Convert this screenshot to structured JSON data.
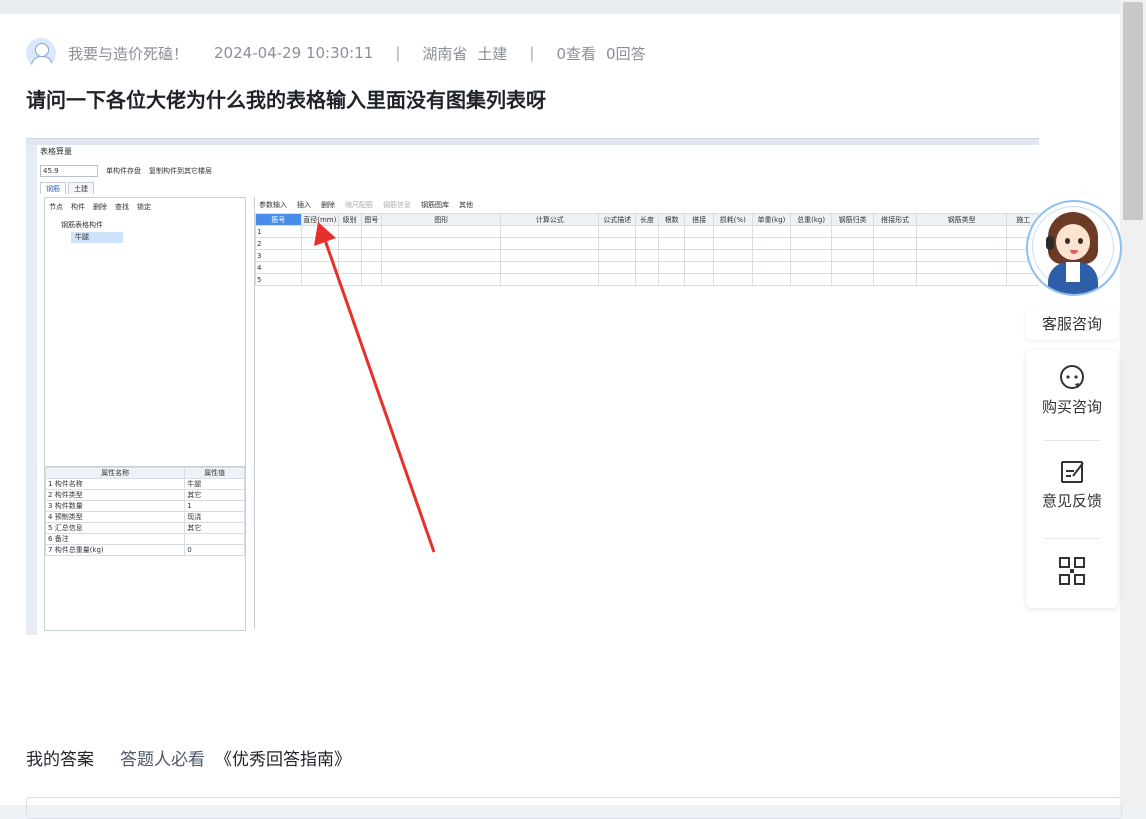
{
  "question": {
    "author": "我要与造价死磕！",
    "datetime": "2024-04-29 10:30:11",
    "separator": "|",
    "region": "湖南省",
    "category": "土建",
    "views": "0查看",
    "answers": "0回答",
    "title": "请问一下各位大佬为什么我的表格输入里面没有图集列表呀"
  },
  "screenshot": {
    "window_title": "表格算量",
    "floor_select": "45.9",
    "toolbar1": [
      "单构件存盘",
      "复制构件到其它楼层"
    ],
    "tabs": [
      "钢筋",
      "土建"
    ],
    "left_toolbar": [
      "节点",
      "构件",
      "删除",
      "查找",
      "锁定"
    ],
    "tree_root": "钢筋表格构件",
    "tree_child": "牛腿",
    "prop_headers": [
      "属性名称",
      "属性值"
    ],
    "props": [
      {
        "n": "1",
        "name": "构件名称",
        "value": "牛腿"
      },
      {
        "n": "2",
        "name": "构件类型",
        "value": "其它"
      },
      {
        "n": "3",
        "name": "构件数量",
        "value": "1"
      },
      {
        "n": "4",
        "name": "预制类型",
        "value": "现浇"
      },
      {
        "n": "5",
        "name": "汇总信息",
        "value": "其它"
      },
      {
        "n": "6",
        "name": "备注",
        "value": ""
      },
      {
        "n": "7",
        "name": "构件总重量(kg)",
        "value": "0"
      }
    ],
    "right_toolbar": [
      "参数输入",
      "插入",
      "删除",
      "缩尺配筋",
      "钢筋信息",
      "钢筋图库",
      "其他"
    ],
    "grid_headers": [
      "筋号",
      "直径(mm)",
      "级别",
      "图号",
      "图形",
      "计算公式",
      "公式描述",
      "长度",
      "根数",
      "搭接",
      "损耗(%)",
      "单重(kg)",
      "总重(kg)",
      "钢筋归类",
      "搭接形式",
      "钢筋类型",
      "施工"
    ],
    "grid_rows": [
      "1",
      "2",
      "3",
      "4",
      "5"
    ]
  },
  "answer_bar": {
    "my_answer": "我的答案",
    "must_read": "答题人必看",
    "guide": "《优秀回答指南》"
  },
  "sidebar": {
    "service": "客服咨询",
    "buy": "购买咨询",
    "feedback": "意见反馈",
    "icons": [
      "chat-bubble-icon",
      "feedback-edit-icon",
      "qr-code-icon"
    ]
  },
  "colors": {
    "arrow": "#e8302a",
    "accent": "#4a8de8"
  }
}
